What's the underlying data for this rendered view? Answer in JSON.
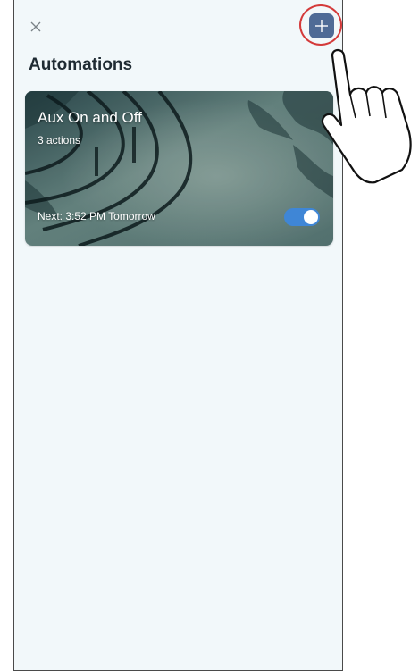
{
  "header": {
    "close_icon": "close-icon",
    "add_icon": "plus-icon",
    "title": "Automations"
  },
  "automations": [
    {
      "name": "Aux On and Off",
      "actions": "3 actions",
      "next_run": "Next: 3:52 PM Tomorrow",
      "enabled": true,
      "background": "palm-tree-pool-photo"
    }
  ],
  "overlay": {
    "pointer_icon": "pointing-hand-icon",
    "highlight_color": "#d43a3a"
  },
  "colors": {
    "page_bg": "#f2f8fa",
    "add_button": "#4f6b96",
    "toggle_on": "#3f86d6",
    "title_text": "#1f2b33"
  }
}
